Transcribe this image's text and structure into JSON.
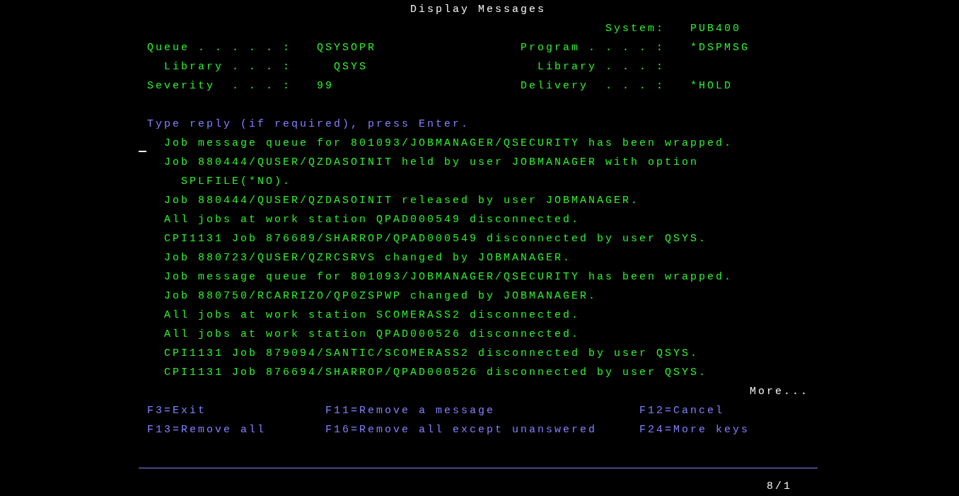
{
  "title": "Display Messages",
  "system": {
    "label": "System:",
    "value": "PUB400"
  },
  "left_fields": [
    {
      "label": "Queue . . . . . :",
      "value": "QSYSOPR",
      "kind": "main"
    },
    {
      "label": "Library . . . :",
      "value": "QSYS",
      "kind": "sub"
    },
    {
      "label": "Severity  . . . :",
      "value": "99",
      "kind": "main"
    }
  ],
  "right_fields": [
    {
      "label": "Program . . . . :",
      "value": "*DSPMSG",
      "kind": "main"
    },
    {
      "label": "Library . . . :",
      "kind": "sub"
    },
    {
      "label": "Delivery  . . . :",
      "value": "*HOLD",
      "kind": "main"
    }
  ],
  "instruction": "Type reply (if required), press Enter.",
  "messages": [
    {
      "text": "Job message queue for 801093/JOBMANAGER/QSECURITY has been wrapped.",
      "kind": "first"
    },
    {
      "text": "Job 880444/QUSER/QZDASOINIT held by user JOBMANAGER with option",
      "kind": "first"
    },
    {
      "text": "SPLFILE(*NO).",
      "kind": "continuation"
    },
    {
      "text": "Job 880444/QUSER/QZDASOINIT released by user JOBMANAGER.",
      "kind": "first"
    },
    {
      "text": "All jobs at work station QPAD000549 disconnected.",
      "kind": "first"
    },
    {
      "text": "CPI1131 Job 876689/SHARROP/QPAD000549 disconnected by user QSYS.",
      "kind": "first"
    },
    {
      "text": "Job 880723/QUSER/QZRCSRVS changed by JOBMANAGER.",
      "kind": "first"
    },
    {
      "text": "Job message queue for 801093/JOBMANAGER/QSECURITY has been wrapped.",
      "kind": "first"
    },
    {
      "text": "Job 880750/RCARRIZO/QP0ZSPWP changed by JOBMANAGER.",
      "kind": "first"
    },
    {
      "text": "All jobs at work station SCOMERASS2 disconnected.",
      "kind": "first"
    },
    {
      "text": "All jobs at work station QPAD000526 disconnected.",
      "kind": "first"
    },
    {
      "text": "CPI1131 Job 879094/SANTIC/SCOMERASS2 disconnected by user QSYS.",
      "kind": "first"
    },
    {
      "text": "CPI1131 Job 876694/SHARROP/QPAD000526 disconnected by user QSYS.",
      "kind": "first"
    }
  ],
  "more": "More...",
  "function_keys": [
    "F3=Exit",
    "F11=Remove a message",
    "F12=Cancel",
    "F13=Remove all",
    "F16=Remove all except unanswered",
    "F24=More keys"
  ],
  "status_bar": {
    "position": "8/1"
  }
}
